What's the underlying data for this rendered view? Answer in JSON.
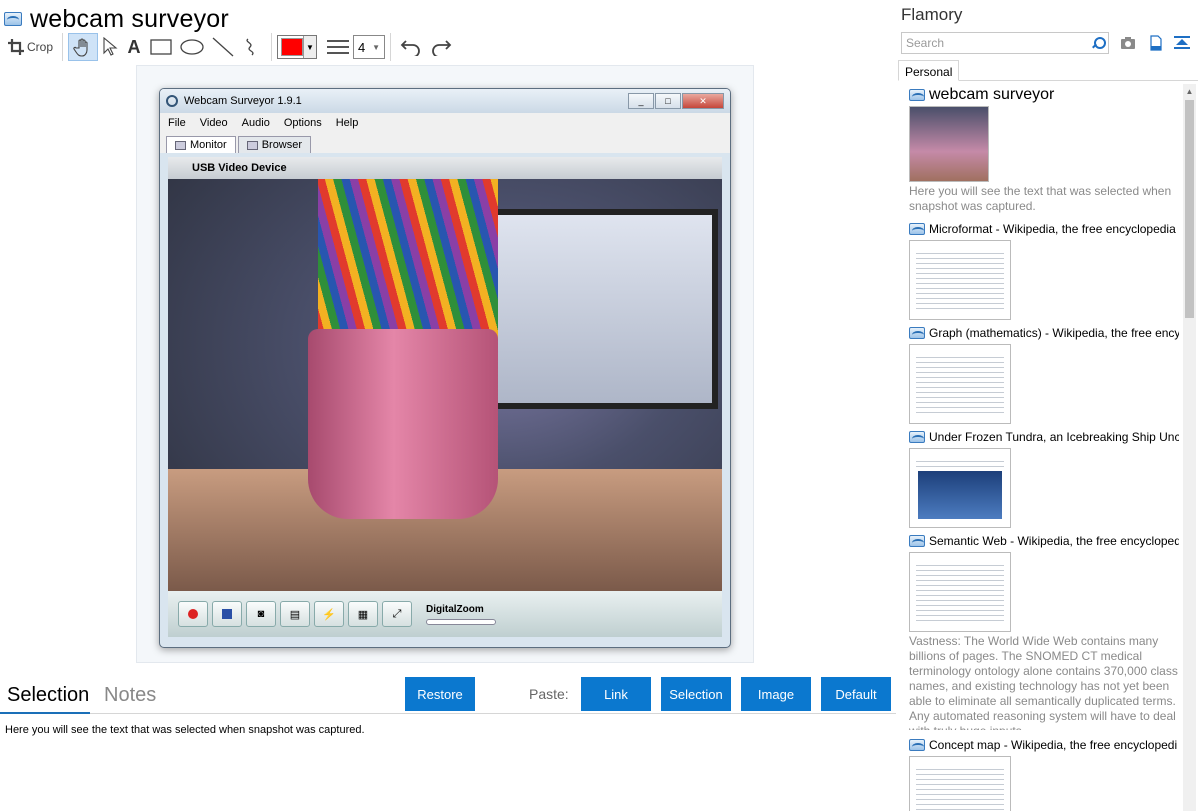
{
  "document": {
    "title": "webcam surveyor"
  },
  "toolbar": {
    "crop_label": "Crop",
    "text_tool": "A",
    "line_width": "4",
    "color": "#ff0000"
  },
  "snapshot": {
    "window_title": "Webcam Surveyor 1.9.1",
    "menu": [
      "File",
      "Video",
      "Audio",
      "Options",
      "Help"
    ],
    "tabs": [
      "Monitor",
      "Browser"
    ],
    "device": "USB Video Device",
    "zoom_label": "DigitalZoom"
  },
  "bottom": {
    "tabs": {
      "selection": "Selection",
      "notes": "Notes"
    },
    "buttons": {
      "restore": "Restore",
      "link": "Link",
      "selection": "Selection",
      "image": "Image",
      "default": "Default"
    },
    "paste_label": "Paste:",
    "selection_text": "Here you will see the text that was selected when snapshot was captured."
  },
  "sidebar": {
    "app_name": "Flamory",
    "search_placeholder": "Search",
    "tab": "Personal",
    "items": [
      {
        "title": "webcam surveyor",
        "desc": "Here you will see the text that was selected when snapshot was captured."
      },
      {
        "title": "Microformat - Wikipedia, the free encyclopedia",
        "desc": ""
      },
      {
        "title": "Graph (mathematics) - Wikipedia, the free ency",
        "desc": ""
      },
      {
        "title": "Under Frozen Tundra, an Icebreaking Ship Unco",
        "desc": ""
      },
      {
        "title": "Semantic Web - Wikipedia, the free encycloped",
        "desc": "Vastness: The World Wide Web contains many billions of pages. The SNOMED CT medical terminology ontology alone contains 370,000 class names, and existing technology has not yet been able to eliminate all semantically duplicated terms. Any automated reasoning system will have to deal with truly huge inputs."
      },
      {
        "title": "Concept map - Wikipedia, the free encyclopedi",
        "desc": ""
      }
    ]
  },
  "colors": {
    "accent": "#0b78cf",
    "selection_underline": "#1a6fb8"
  }
}
